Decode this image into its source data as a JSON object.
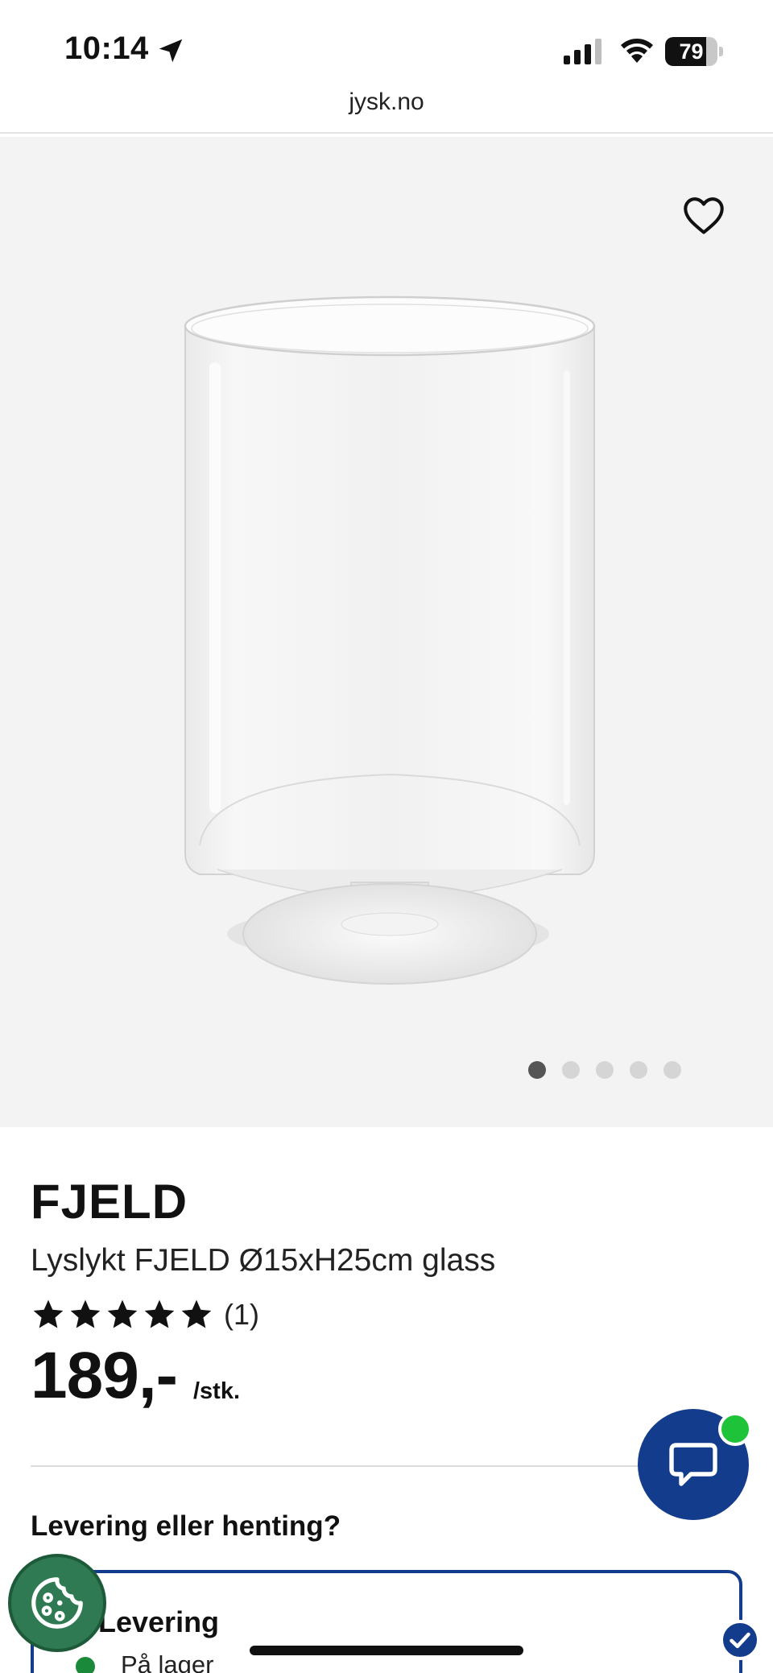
{
  "status_bar": {
    "time": "10:14",
    "battery_level": "79",
    "battery_fraction": 0.79
  },
  "browser": {
    "url": "jysk.no"
  },
  "gallery": {
    "image_count": 5,
    "active_index": 0,
    "favorite_icon": "heart-outline-icon"
  },
  "product": {
    "brand": "FJELD",
    "name": "Lyslykt FJELD Ø15xH25cm glass",
    "rating_stars": 5,
    "rating_count": "(1)",
    "price": "189,-",
    "price_unit": "/stk."
  },
  "delivery": {
    "heading": "Levering eller henting?",
    "option_title": "Levering",
    "stock_status": "På lager",
    "selected": true
  },
  "colors": {
    "brand_blue": "#143c8c",
    "online_green": "#1ec33a",
    "stock_green": "#1a8a3a",
    "cookie_green": "#2f7a52"
  },
  "icons": {
    "location": "location-arrow-icon",
    "signal": "cellular-signal-icon",
    "wifi": "wifi-icon",
    "star": "star-icon",
    "chat": "chat-bubble-icon",
    "cookie": "cookie-icon",
    "check": "checkmark-icon"
  }
}
